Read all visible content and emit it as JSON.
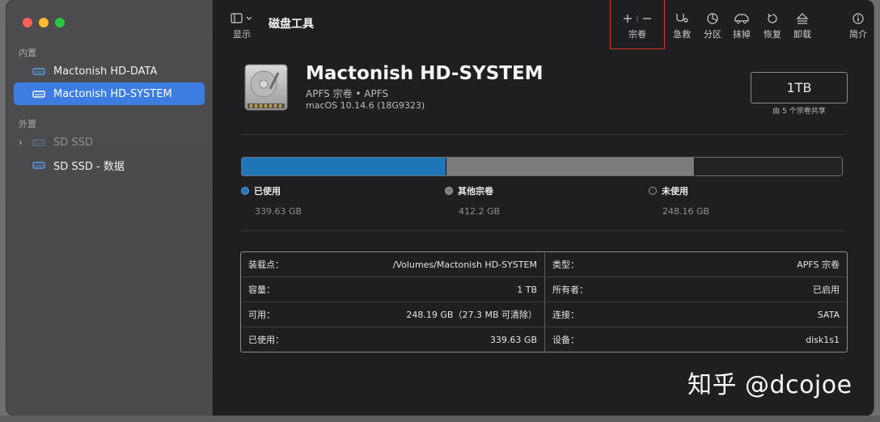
{
  "sidebar": {
    "section_internal": "内置",
    "section_external": "外置",
    "items": [
      {
        "label": "Mactonish HD-DATA"
      },
      {
        "label": "Mactonish HD-SYSTEM"
      },
      {
        "label": "SD SSD"
      },
      {
        "label": "SD SSD - 数据"
      }
    ]
  },
  "toolbar": {
    "view_label": "显示",
    "title": "磁盘工具",
    "add_remove_label": "宗卷",
    "first_aid_label": "急救",
    "partition_label": "分区",
    "erase_label": "抹掉",
    "restore_label": "恢复",
    "unmount_label": "卸载",
    "info_label": "简介"
  },
  "volume": {
    "name": "Mactonish HD-SYSTEM",
    "subtitle": "APFS 宗卷 • APFS",
    "os": "macOS 10.14.6 (18G9323)",
    "capacity": "1TB",
    "capacity_note": "由 5 个宗卷共享"
  },
  "usage": {
    "used_fraction": 0.3397,
    "other_fraction": 0.4122,
    "free_fraction": 0.2481,
    "legend": [
      {
        "label": "已使用",
        "value": "339.63 GB",
        "color": "#1e76b8"
      },
      {
        "label": "其他宗卷",
        "value": "412.2 GB",
        "color": "#7c7c7e"
      },
      {
        "label": "未使用",
        "value": "248.16 GB",
        "color": "#232325"
      }
    ]
  },
  "info": {
    "left": [
      {
        "key": "装载点：",
        "value": "/Volumes/Mactonish HD-SYSTEM"
      },
      {
        "key": "容量：",
        "value": "1 TB"
      },
      {
        "key": "可用：",
        "value": "248.19 GB（27.3 MB 可清除）"
      },
      {
        "key": "已使用：",
        "value": "339.63 GB"
      }
    ],
    "right": [
      {
        "key": "类型：",
        "value": "APFS 宗卷"
      },
      {
        "key": "所有者：",
        "value": "已启用"
      },
      {
        "key": "连接：",
        "value": "SATA"
      },
      {
        "key": "设备：",
        "value": "disk1s1"
      }
    ]
  },
  "watermark": "知乎 @dcojoe",
  "colors": {
    "accent": "#3d7de1",
    "used": "#1e76b8",
    "other": "#7c7c7e",
    "highlight": "#d9352a"
  }
}
